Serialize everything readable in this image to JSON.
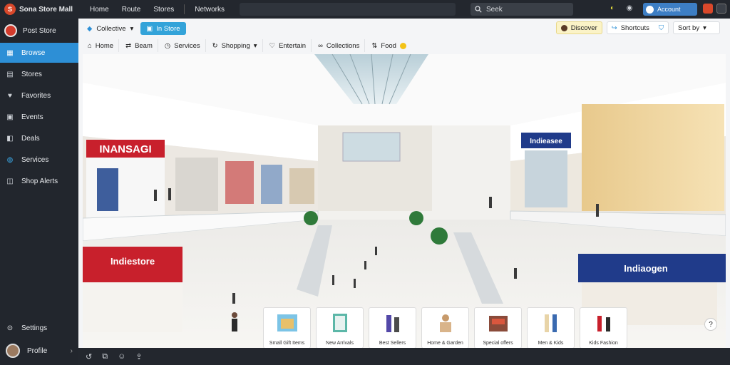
{
  "app": {
    "name": "Sona Store Mall",
    "logo_letter": "S"
  },
  "topnav": {
    "items": [
      "Home",
      "Route",
      "Stores",
      "Networks"
    ]
  },
  "search": {
    "placeholder": "Seek"
  },
  "account": {
    "label": "Account"
  },
  "sidebar": {
    "user_name": "Post Store",
    "items": [
      {
        "label": "Browse",
        "icon": "map-icon",
        "active": true
      },
      {
        "label": "Stores",
        "icon": "store-icon",
        "active": false
      },
      {
        "label": "Favorites",
        "icon": "heart-icon",
        "active": false
      },
      {
        "label": "Events",
        "icon": "calendar-icon",
        "active": false
      },
      {
        "label": "Deals",
        "icon": "tag-icon",
        "active": false
      },
      {
        "label": "Services",
        "icon": "globe-icon",
        "active": false
      },
      {
        "label": "Shop Alerts",
        "icon": "bell-icon",
        "active": false
      }
    ],
    "footer": {
      "settings_label": "Settings",
      "profile_label": "Profile"
    }
  },
  "toolbar": {
    "dropdown_label": "Collective",
    "pill_label": "In Store",
    "right": {
      "chip1": "Discover",
      "chip2": "Shortcuts",
      "select_value": "Sort by"
    }
  },
  "filters": [
    {
      "label": "Home",
      "icon": "home-icon"
    },
    {
      "label": "Beam",
      "icon": "shuffle-icon"
    },
    {
      "label": "Services",
      "icon": "clock-icon"
    },
    {
      "label": "Shopping",
      "icon": "refresh-icon"
    },
    {
      "label": "Entertain",
      "icon": "heart-outline-icon"
    },
    {
      "label": "Collections",
      "icon": "link-icon"
    },
    {
      "label": "Food",
      "icon": "swap-icon"
    }
  ],
  "scene": {
    "store_sign_left": "INANSAGI",
    "store_sign_lower_left": "Indiestore",
    "store_sign_right": "Indieasee",
    "store_sign_lower_right": "Indiaogen"
  },
  "thumbnails": [
    "Small Gift Items",
    "New Arrivals",
    "Best Sellers",
    "Home & Garden",
    "Special offers",
    "Men & Kids",
    "Kids Fashion"
  ],
  "colors": {
    "accent": "#2d8fd6",
    "pill": "#33a3d9",
    "sign_red": "#c8202c",
    "sign_blue": "#203b8a"
  }
}
